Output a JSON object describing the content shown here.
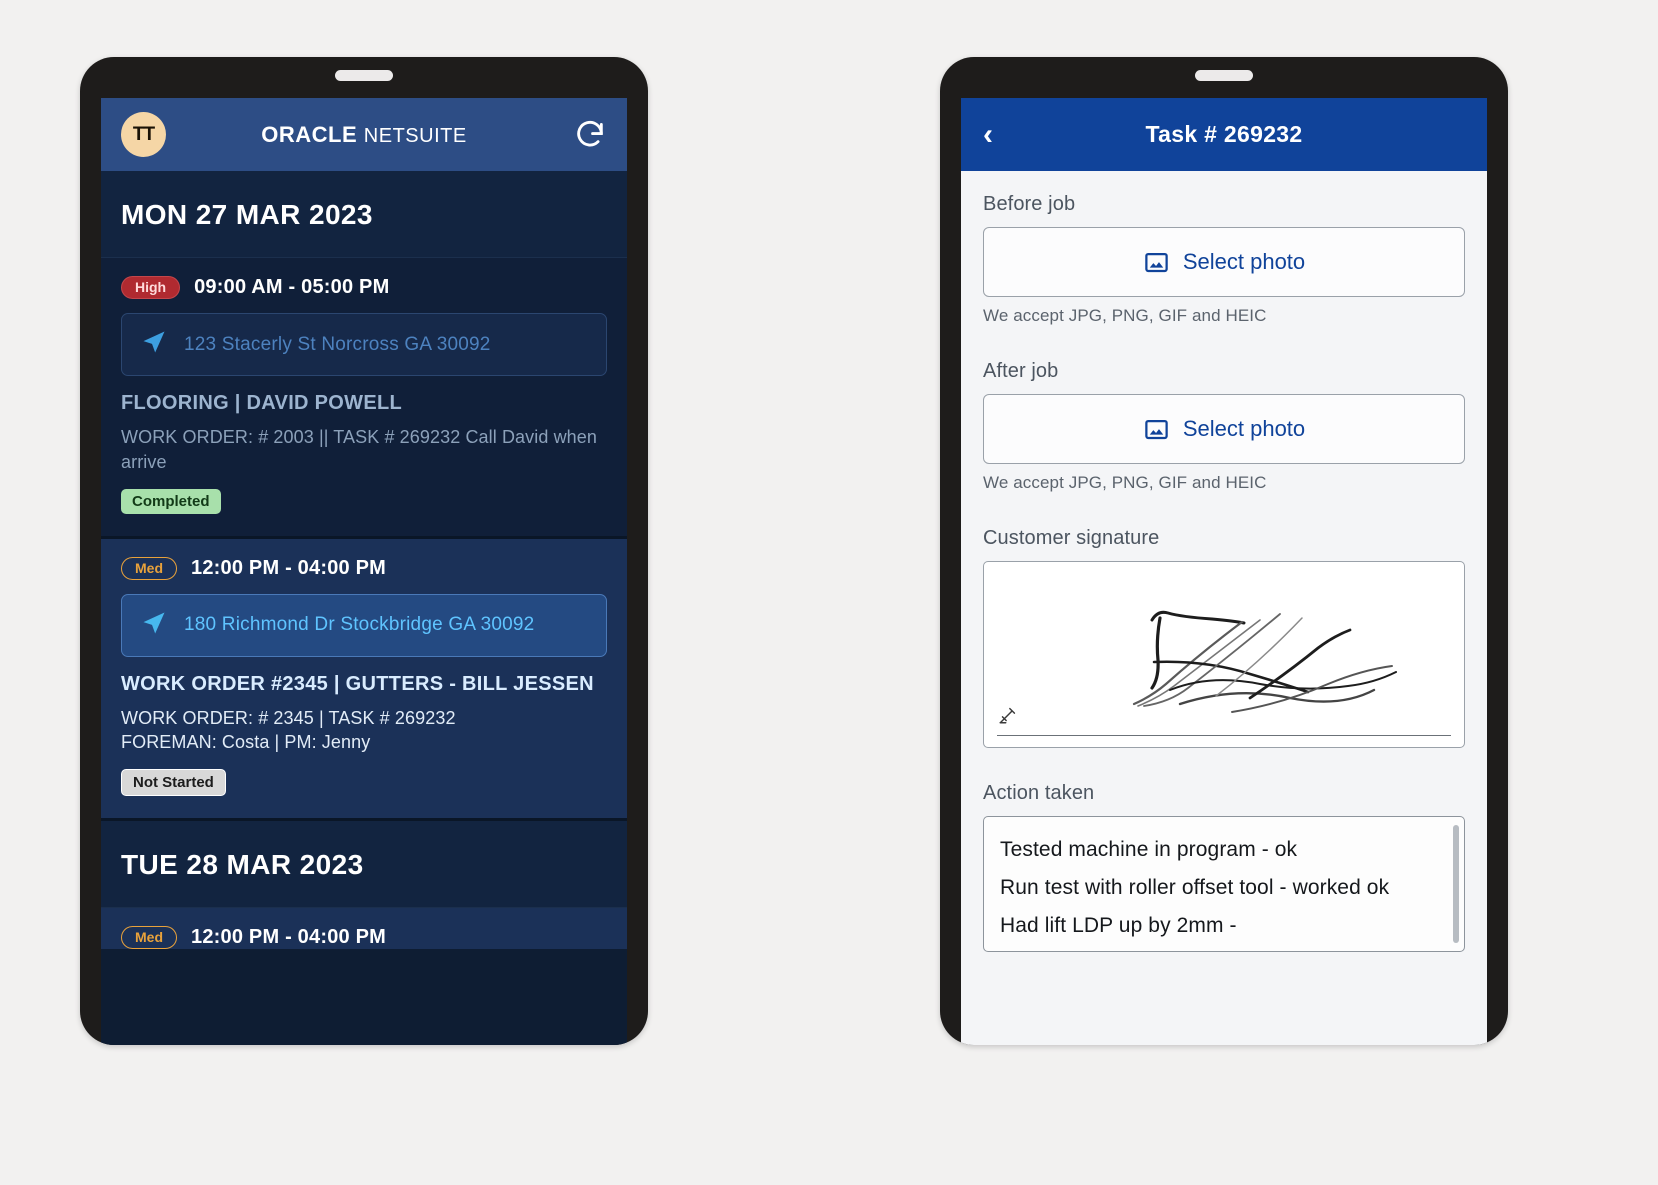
{
  "left_phone": {
    "topbar": {
      "avatar_initials": "TT",
      "brand_primary": "ORACLE",
      "brand_secondary": "NETSUITE",
      "refresh_icon": "refresh-icon",
      "bg_color": "#2d4d85"
    },
    "days": [
      {
        "date_label": "MON 27 MAR 2023",
        "tasks": [
          {
            "priority": "High",
            "priority_color": "#b02a30",
            "time_range": "09:00 AM - 05:00 PM",
            "address": "123 Stacerly St Norcross GA 30092",
            "nav_icon": "navigation-arrow-icon",
            "title": "FLOORING  |  DAVID POWELL",
            "details": "WORK ORDER: # 2003 || TASK # 269232 Call David when arrive",
            "status": "Completed",
            "status_color": "#a8e0ab"
          },
          {
            "priority": "Med",
            "priority_color": "#e9a23b",
            "time_range": "12:00 PM - 04:00 PM",
            "address": "180 Richmond Dr Stockbridge GA 30092",
            "nav_icon": "navigation-arrow-icon",
            "title": "WORK ORDER #2345 | GUTTERS - BILL JESSEN",
            "details_line1": "WORK ORDER: # 2345 | TASK # 269232",
            "details_line2": "FOREMAN: Costa | PM: Jenny",
            "status": "Not Started",
            "status_color": "#d8d8d8"
          }
        ]
      },
      {
        "date_label": "TUE 28 MAR 2023",
        "tasks": [
          {
            "priority": "Med",
            "priority_color": "#e9a23b",
            "time_range": "12:00 PM - 04:00 PM"
          }
        ]
      }
    ]
  },
  "right_phone": {
    "topbar": {
      "back_icon": "back-chevron-icon",
      "title": "Task # 269232",
      "bg_color": "#10439a"
    },
    "sections": {
      "before_job": {
        "label": "Before job",
        "button_label": "Select photo",
        "button_icon": "image-icon",
        "hint": "We accept JPG, PNG, GIF and HEIC"
      },
      "after_job": {
        "label": "After job",
        "button_label": "Select photo",
        "button_icon": "image-icon",
        "hint": "We accept JPG, PNG, GIF and HEIC"
      },
      "customer_signature": {
        "label": "Customer signature",
        "clear_icon": "clear-signature-icon"
      },
      "action_taken": {
        "label": "Action taken",
        "lines": [
          "Tested machine in program - ok",
          "Run test with roller offset tool - worked ok",
          "Had lift LDP up by 2mm -"
        ]
      }
    }
  }
}
